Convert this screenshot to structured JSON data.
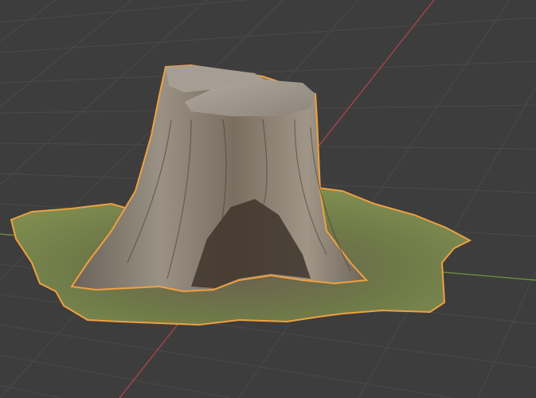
{
  "viewport": {
    "background_color": "#3d3d3d",
    "grid_color": "#4a4a4a",
    "x_axis_color": "#b5454d",
    "y_axis_color": "#6f9a3a",
    "selection_outline_color": "#f0a040"
  },
  "scene": {
    "object": {
      "kind": "scanned-tree-stump-mesh",
      "selected": true,
      "bark_color": "#8a8072",
      "bark_dark_color": "#4a4036",
      "cut_top_color": "#a39b90",
      "grass_color": "#6f7d48",
      "soil_color": "#6e6252"
    }
  }
}
